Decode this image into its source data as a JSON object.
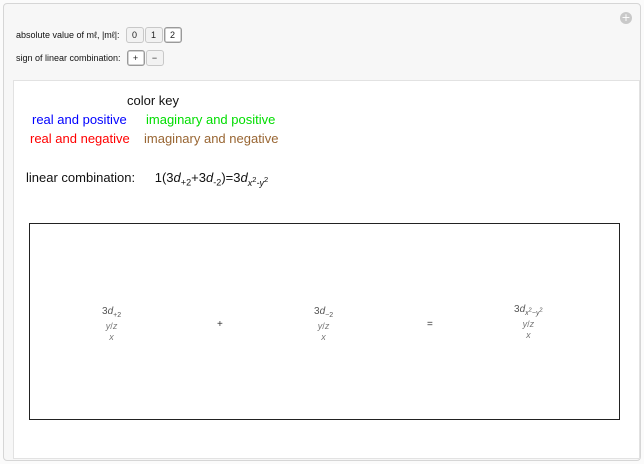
{
  "controls": {
    "ml_label": "absolute value of mℓ, |mℓ|:",
    "ml_options": [
      "0",
      "1",
      "2"
    ],
    "ml_selected": "2",
    "sign_label": "sign of linear combination:",
    "sign_options": [
      "+",
      "−"
    ],
    "sign_selected": "+"
  },
  "color_key": {
    "title": "color key",
    "real_positive": "real and positive",
    "imag_positive": "imaginary and positive",
    "real_negative": "real and negative",
    "imag_negative": "imaginary and negative",
    "colors": {
      "real_positive": "#0000ff",
      "imag_positive": "#00dd00",
      "real_negative": "#ff0000",
      "imag_negative": "#996633"
    }
  },
  "linear_combination": {
    "label": "linear combination:",
    "coef": "1(3",
    "d1": "d",
    "d1_sub": "+2",
    "plus": "+3",
    "d2": "d",
    "d2_sub": "-2",
    "eq": ")=3",
    "d3": "d",
    "d3_sub": "x",
    "d3_sub2": "2",
    "d3_sub3": "-y",
    "d3_sub4": "2"
  },
  "plot": {
    "orbital1_prefix": "3",
    "orbital1_d": "d",
    "orbital1_sub": "+2",
    "orbital2_prefix": "3",
    "orbital2_d": "d",
    "orbital2_sub": "−2",
    "orbital3_prefix": "3",
    "orbital3_d": "d",
    "orbital3_sub": "x",
    "orbital3_sub2": "2",
    "orbital3_sub3": "−y",
    "orbital3_sub4": "2",
    "axis_y": "y",
    "axis_z": "z",
    "axis_x": "x",
    "plus_sign": "+",
    "equals_sign": "="
  }
}
